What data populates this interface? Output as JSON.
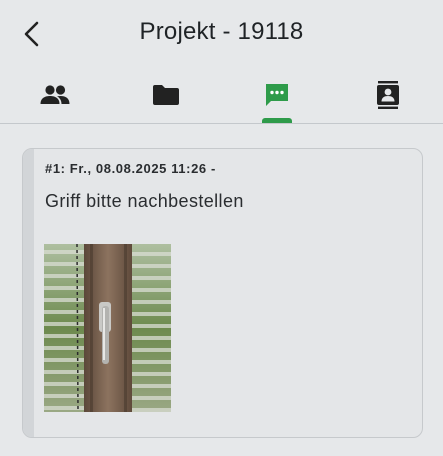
{
  "header": {
    "title": "Projekt - 19118",
    "back_icon": "chevron-left-icon"
  },
  "tabs": [
    {
      "icon": "people-icon",
      "active": false
    },
    {
      "icon": "folder-icon",
      "active": false
    },
    {
      "icon": "chat-icon",
      "active": true
    },
    {
      "icon": "contact-book-icon",
      "active": false
    }
  ],
  "colors": {
    "accent": "#2e9b4a",
    "background": "#e6e8ea",
    "text": "#1f2326"
  },
  "entries": [
    {
      "meta": "#1: Fr., 08.08.2025 11:26 -",
      "message": "Griff bitte nachbestellen",
      "attachment": "window-handle-photo"
    }
  ]
}
